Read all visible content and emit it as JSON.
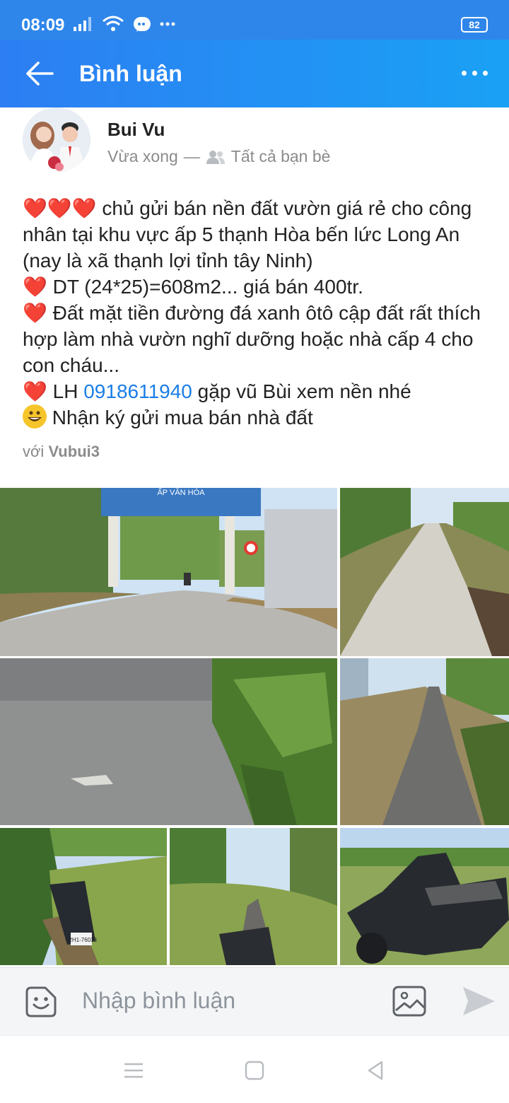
{
  "status_bar": {
    "time": "08:09",
    "battery": "82"
  },
  "app_bar": {
    "title": "Bình luận"
  },
  "post": {
    "author": "Bui Vu",
    "time_text": "Vừa xong",
    "separator": "—",
    "audience": "Tất cả bạn bè",
    "lines": [
      {
        "icon": "❤️❤️❤️",
        "text": " chủ gửi bán nền đất vườn giá rẻ cho công nhân tại khu vực ấp 5 thạnh Hòa bến lức Long An (nay là xã thạnh lợi tỉnh tây Ninh)"
      },
      {
        "icon": "❤️",
        "text": " DT (24*25)=608m2... giá bán 400tr."
      },
      {
        "icon": "❤️",
        "text": " Đất mặt tiền đường đá xanh ôtô cập đất rất thích hợp làm nhà vườn nghĩ dưỡng hoặc nhà cấp 4 cho con cháu..."
      }
    ],
    "contact": {
      "icon": "❤️",
      "prefix": " LH ",
      "phone": "0918611940",
      "suffix": " gặp vũ Bùi xem nền nhé"
    },
    "service_text": " Nhận ký gửi mua bán nhà đất",
    "with_label": "với",
    "tagged_user": "Vubui3",
    "photo_signs": {
      "banner": "ẤP VĂN HÓA",
      "plate": "62H1-76033"
    }
  },
  "comment_bar": {
    "placeholder": "Nhập bình luận"
  },
  "colors": {
    "app_bar_start": "#2d7ef2",
    "app_bar_end": "#1aa1f5",
    "link_blue": "#1b7ee6",
    "heart_red": "#d61f1f"
  }
}
